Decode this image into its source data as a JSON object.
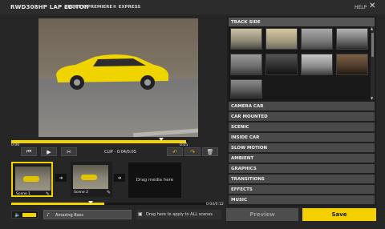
{
  "header": {
    "title": "RWD308HP LAP EDITOR",
    "subtitle": "ADOBE® PREMIERE® EXPRESS",
    "help_label": "HELP",
    "close_glyph": "✕"
  },
  "player": {
    "time_start": "0:00",
    "time_end": "0:05",
    "clip_label": "CLIP - 0:04/0:05",
    "scrub_progress": 0.84
  },
  "scenes": [
    {
      "name": "Scene 1",
      "selected": true
    },
    {
      "name": "Scene 2",
      "selected": false
    }
  ],
  "dropzone_text": "Drag media here",
  "timeline": {
    "time": "0:04/0:12",
    "progress": 0.45
  },
  "audio": {
    "music_label": "Amazing Bass",
    "apply_all_label": "Drag here to apply to ALL scenes"
  },
  "categories": {
    "track_side": "TRACK SIDE",
    "items": [
      "CAMERA CAR",
      "CAR MOUNTED",
      "SCENIC",
      "INSIDE CAR",
      "SLOW MOTION",
      "AMBIENT",
      "GRAPHICS",
      "TRANSITIONS",
      "EFFECTS",
      "MUSIC"
    ]
  },
  "buttons": {
    "preview": "Preview",
    "save": "Save"
  },
  "colors": {
    "accent": "#f2d200",
    "panel": "#4a4a4a",
    "background": "#262626"
  },
  "icons": [
    "close-icon",
    "skip-back-icon",
    "play-icon",
    "shuffle-icon",
    "undo-icon",
    "redo-icon",
    "trash-icon",
    "wrench-icon",
    "arrow-right-icon",
    "speaker-icon",
    "music-note-icon"
  ]
}
